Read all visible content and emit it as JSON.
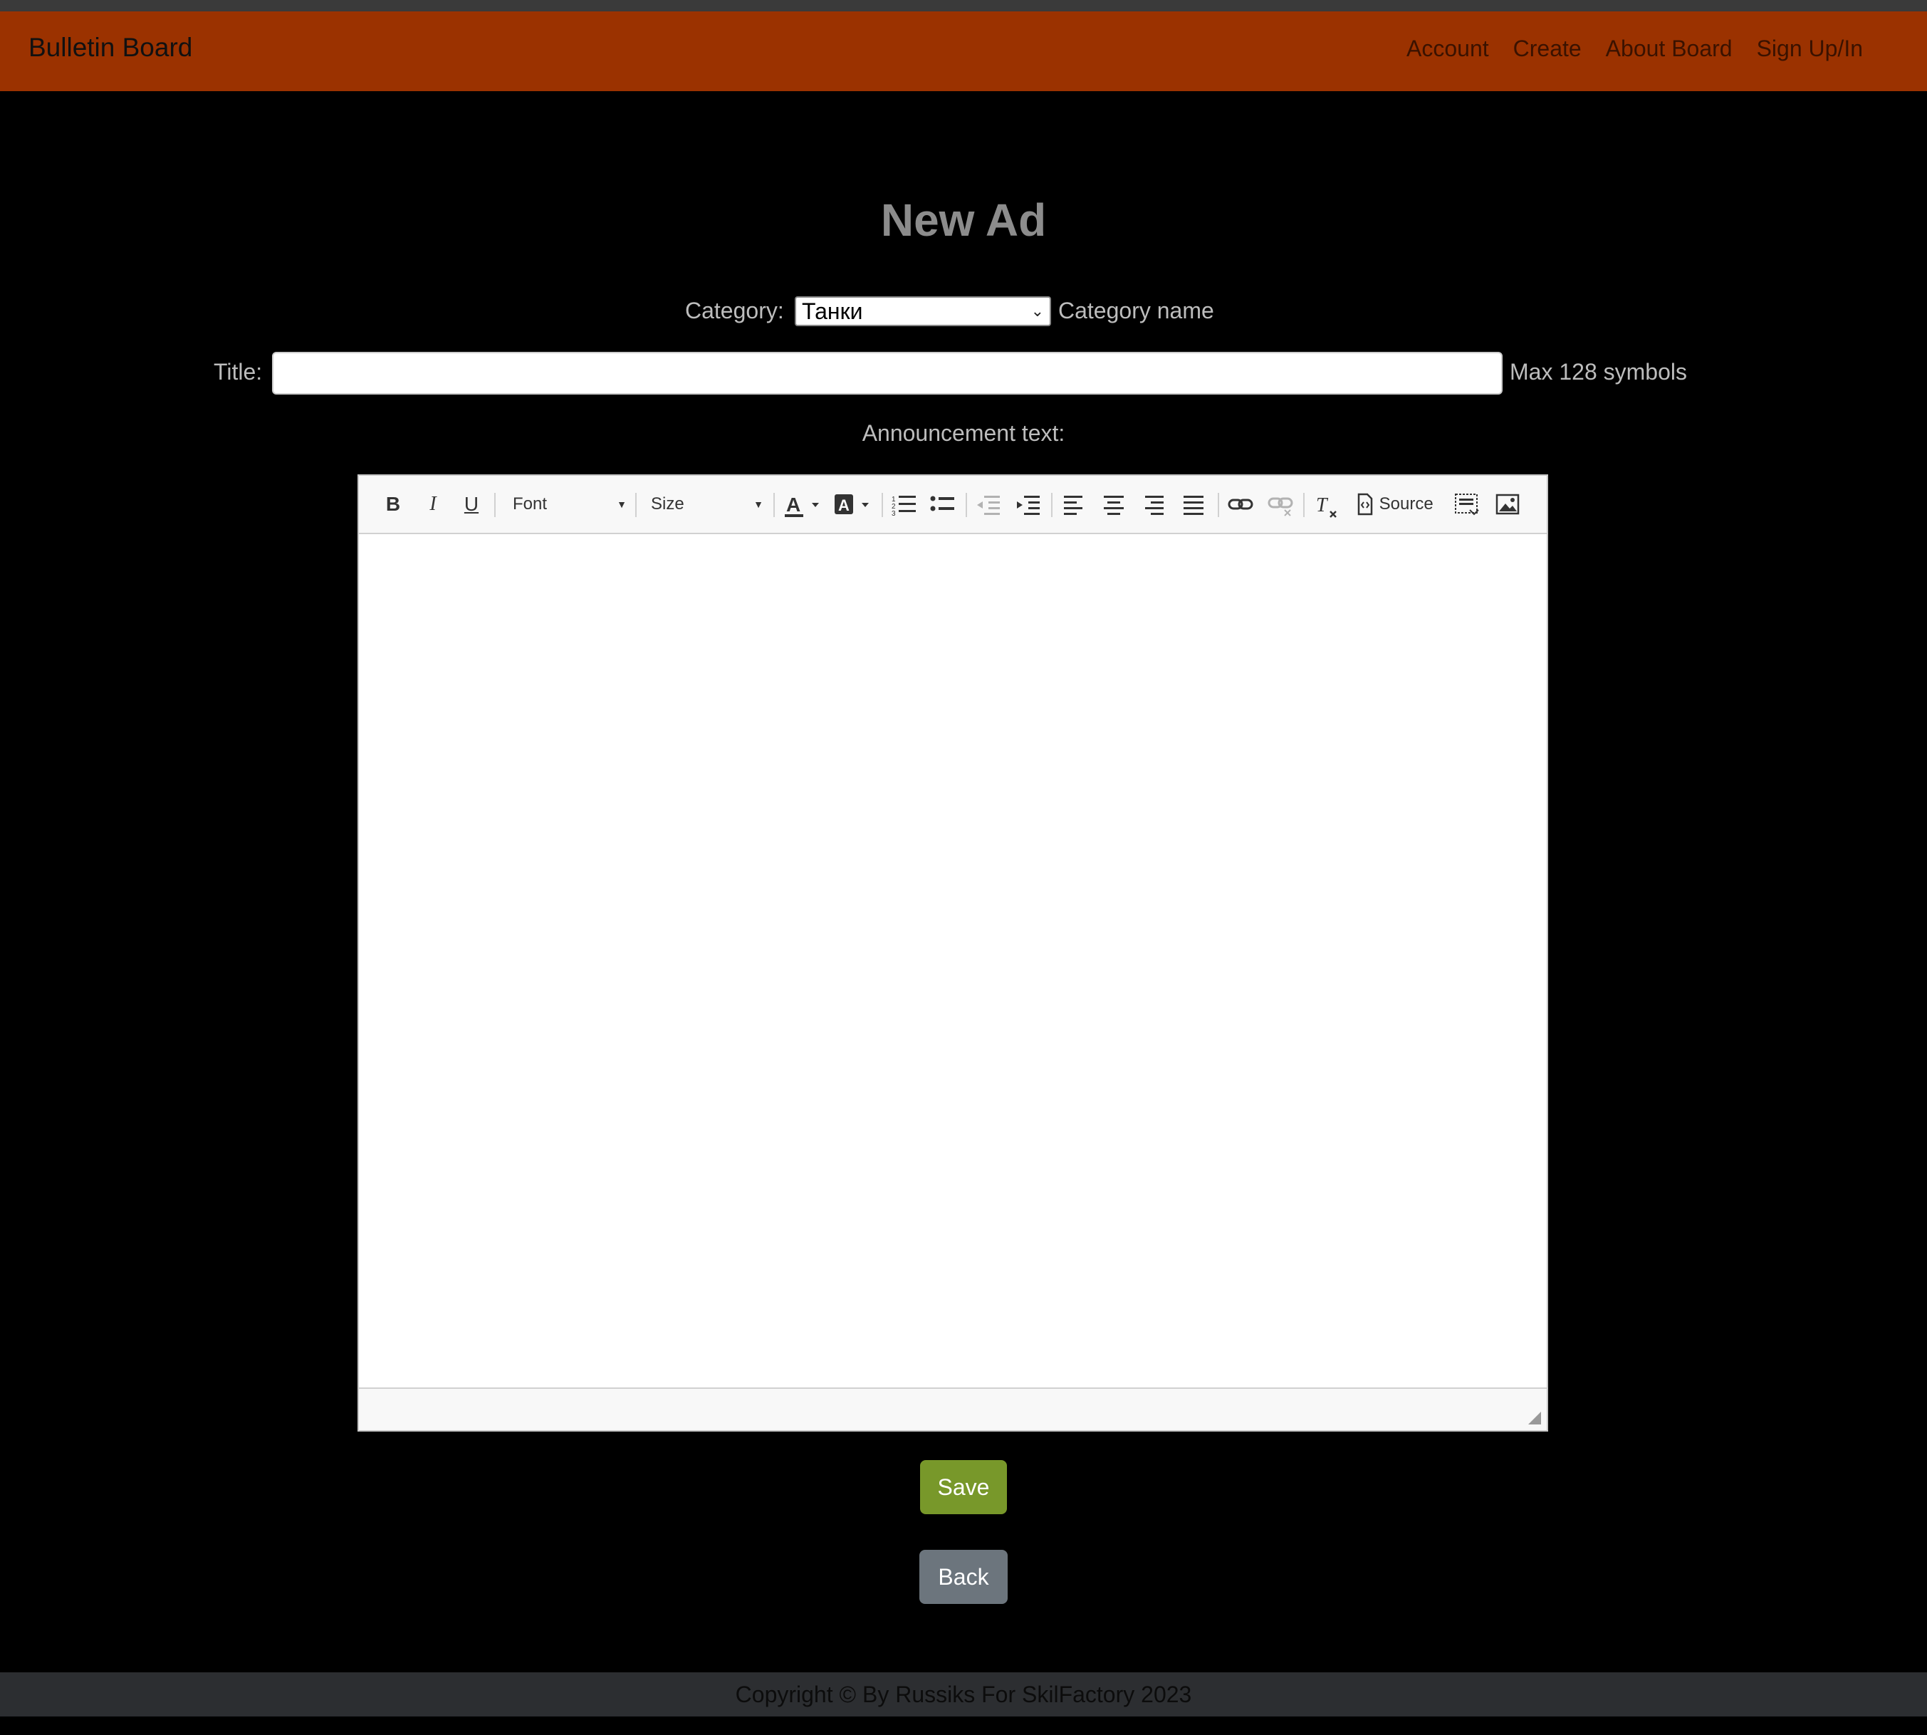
{
  "navbar": {
    "brand": "Bulletin Board",
    "links": [
      "Account",
      "Create",
      "About Board",
      "Sign Up/In"
    ],
    "color": "#9b3200"
  },
  "page": {
    "heading": "New Ad"
  },
  "form": {
    "category_label": "Category:",
    "category_value": "Танки",
    "category_hint": "Category name",
    "title_label": "Title:",
    "title_value": "",
    "title_hint": "Max 128 symbols",
    "announcement_label": "Announcement text:"
  },
  "editor": {
    "toolbar": {
      "bold": "B",
      "italic": "I",
      "underline": "U",
      "font": "Font",
      "size": "Size",
      "source": "Source"
    }
  },
  "buttons": {
    "save": "Save",
    "back": "Back",
    "save_color": "#78982a",
    "back_color": "#6c757d"
  },
  "footer": {
    "text": "Copyright © By Russiks For SkilFactory 2023"
  }
}
